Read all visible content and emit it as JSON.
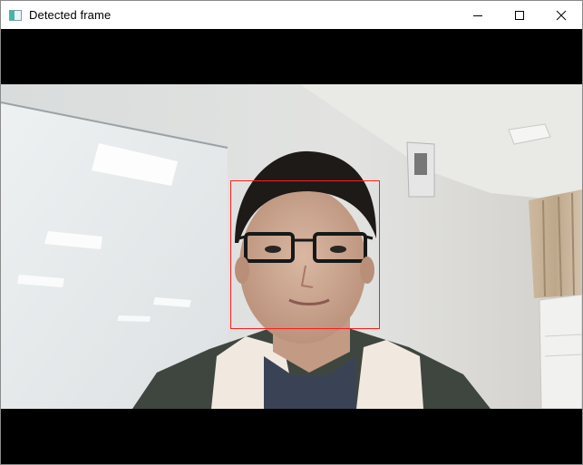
{
  "window": {
    "title": "Detected frame",
    "icon": "opencv-window-icon",
    "controls": [
      "minimize-icon",
      "maximize-icon",
      "close-icon"
    ]
  },
  "frame": {
    "detection_color": "#ff0000"
  }
}
